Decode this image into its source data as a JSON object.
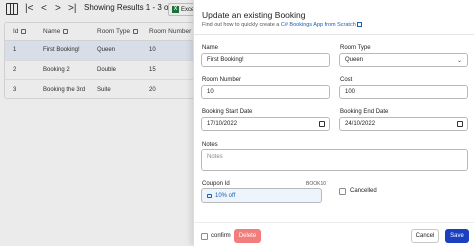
{
  "toolbar": {
    "results": "Showing Results 1 - 3 of 3",
    "excel_label": "Excel",
    "excel_logo": "X",
    "icons": [
      "grid-icon",
      "first-page-icon",
      "prev-page-icon",
      "next-page-icon",
      "last-page-icon"
    ]
  },
  "table": {
    "headers": [
      "Id",
      "Name",
      "Room Type",
      "Room Number"
    ],
    "rows": [
      {
        "id": "1",
        "name": "First Booking!",
        "room_type": "Queen",
        "room_number": "10",
        "selected": true
      },
      {
        "id": "2",
        "name": "Booking 2",
        "room_type": "Double",
        "room_number": "15",
        "selected": false
      },
      {
        "id": "3",
        "name": "Booking the 3rd",
        "room_type": "Suite",
        "room_number": "20",
        "selected": false
      }
    ]
  },
  "panel": {
    "title": "Update an existing Booking",
    "subtitle_prefix": "Find out how to quickly create a ",
    "subtitle_link": "C# Bookings App from Scratch",
    "name_label": "Name",
    "name_value": "First Booking!",
    "room_type_label": "Room Type",
    "room_type_value": "Queen",
    "room_number_label": "Room Number",
    "room_number_value": "10",
    "cost_label": "Cost",
    "cost_value": "100",
    "start_label": "Booking Start Date",
    "start_value": "17/10/2022",
    "end_label": "Booking End Date",
    "end_value": "24/10/2022",
    "notes_label": "Notes",
    "notes_placeholder": "Notes",
    "coupon_label": "Coupon Id",
    "coupon_code": "BOOK10",
    "coupon_value": "10% off",
    "cancelled_label": "Cancelled",
    "confirm_label": "confirm",
    "delete_label": "Delete",
    "cancel_label": "Cancel",
    "save_label": "Save"
  },
  "colors": {
    "primary": "#1a3fbf",
    "danger": "#f17d7d",
    "link": "#1a5fb4",
    "selected_row": "#eaf1fb"
  }
}
